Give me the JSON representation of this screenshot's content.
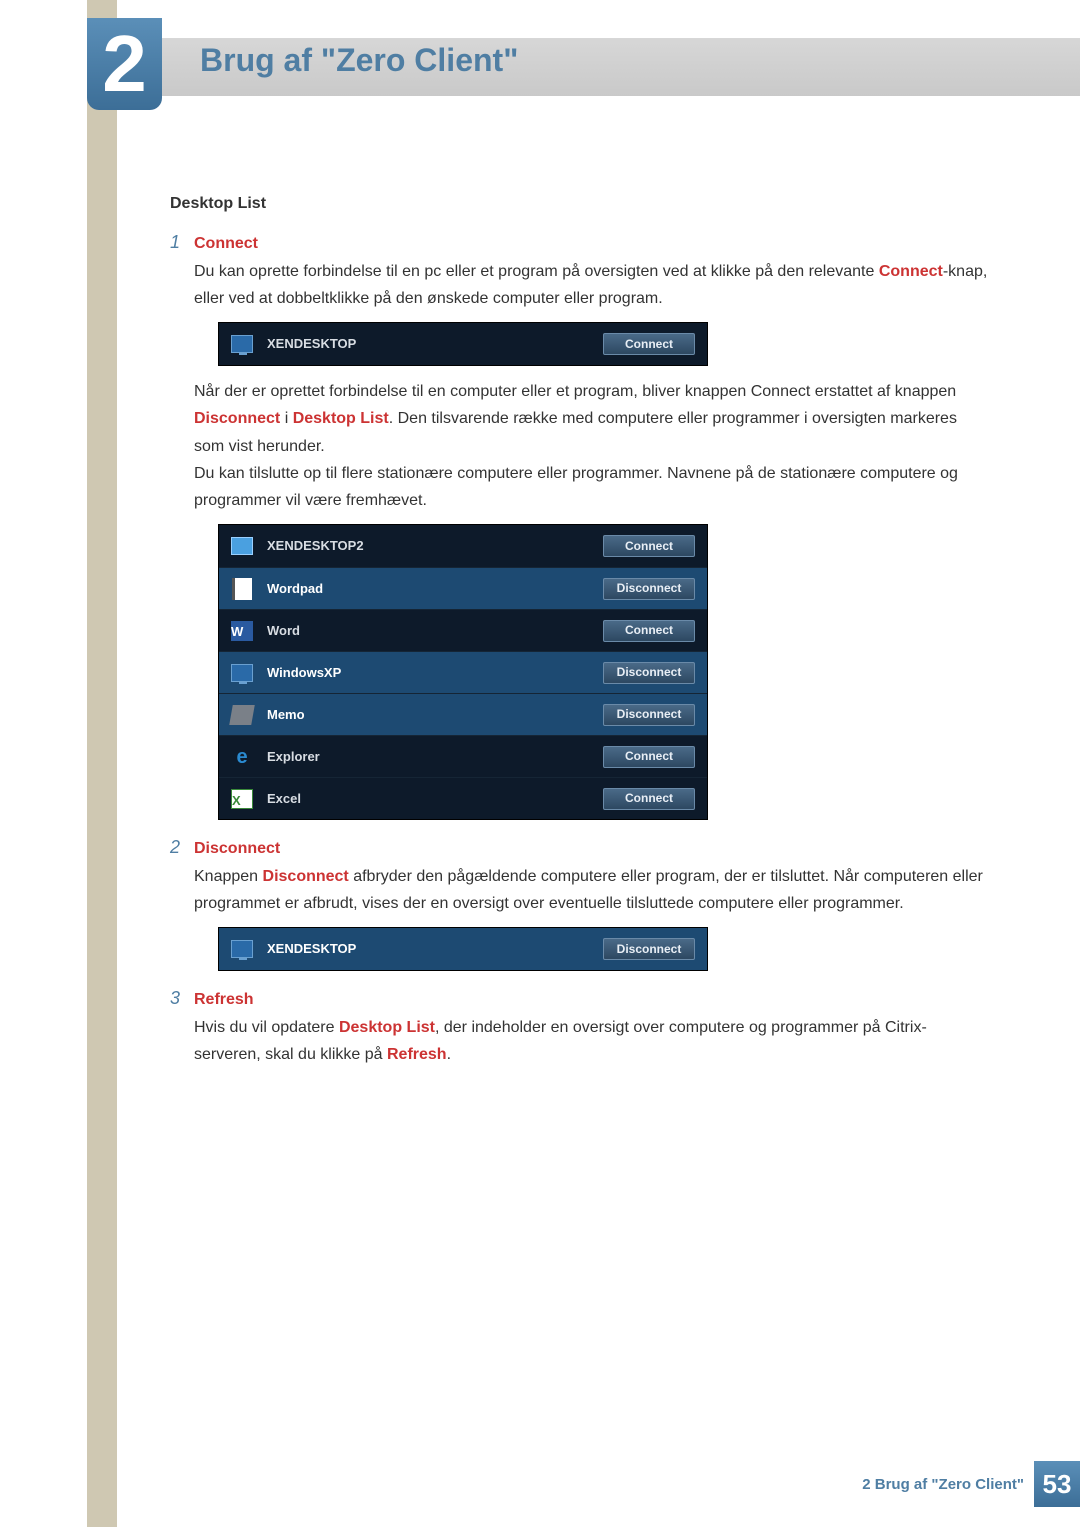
{
  "chapter": {
    "number": "2",
    "title": "Brug af \"Zero Client\""
  },
  "section_heading": "Desktop List",
  "items": {
    "connect": {
      "num": "1",
      "label": "Connect",
      "p1_a": "Du kan oprette forbindelse til en pc eller et program på oversigten ved at klikke på den relevante ",
      "p1_kw": "Connect",
      "p1_b": "-knap, eller ved at dobbeltklikke på den ønskede computer eller program.",
      "p2_a": "Når der er oprettet forbindelse til en computer eller et program, bliver knappen Connect erstattet af knappen ",
      "p2_kw1": "Disconnect",
      "p2_mid": " i ",
      "p2_kw2": "Desktop List",
      "p2_b": ". Den tilsvarende række med computere eller programmer i oversigten markeres som vist herunder.",
      "p3": "Du kan tilslutte op til flere stationære computere eller programmer. Navnene på de stationære computere og programmer vil være fremhævet."
    },
    "disconnect": {
      "num": "2",
      "label": "Disconnect",
      "p_a": "Knappen ",
      "p_kw": "Disconnect",
      "p_b": " afbryder den pågældende computere eller program, der er tilsluttet. Når computeren eller programmet er afbrudt, vises der en oversigt over eventuelle tilsluttede computere eller programmer."
    },
    "refresh": {
      "num": "3",
      "label": "Refresh",
      "p_a": "Hvis du vil opdatere ",
      "p_kw1": "Desktop List",
      "p_mid": ", der indeholder en oversigt over computere og programmer på Citrix-serveren, skal du klikke på ",
      "p_kw2": "Refresh",
      "p_end": "."
    }
  },
  "shots": {
    "single_connect": {
      "name": "XENDESKTOP",
      "btn": "Connect"
    },
    "list": [
      {
        "name": "XENDESKTOP2",
        "btn": "Connect",
        "icon": "desktop-icon",
        "highlight": false
      },
      {
        "name": "Wordpad",
        "btn": "Disconnect",
        "icon": "wordpad-icon",
        "highlight": true
      },
      {
        "name": "Word",
        "btn": "Connect",
        "icon": "word-icon",
        "highlight": false
      },
      {
        "name": "WindowsXP",
        "btn": "Disconnect",
        "icon": "monitor-icon",
        "highlight": true
      },
      {
        "name": "Memo",
        "btn": "Disconnect",
        "icon": "memo-icon",
        "highlight": true
      },
      {
        "name": "Explorer",
        "btn": "Connect",
        "icon": "ie-icon",
        "highlight": false
      },
      {
        "name": "Excel",
        "btn": "Connect",
        "icon": "excel-icon",
        "highlight": false
      }
    ],
    "single_disconnect": {
      "name": "XENDESKTOP",
      "btn": "Disconnect"
    }
  },
  "footer": {
    "text": "2 Brug af \"Zero Client\"",
    "page": "53"
  },
  "icon_glyphs": {
    "word": "W",
    "excel": "X",
    "ie": "e"
  }
}
